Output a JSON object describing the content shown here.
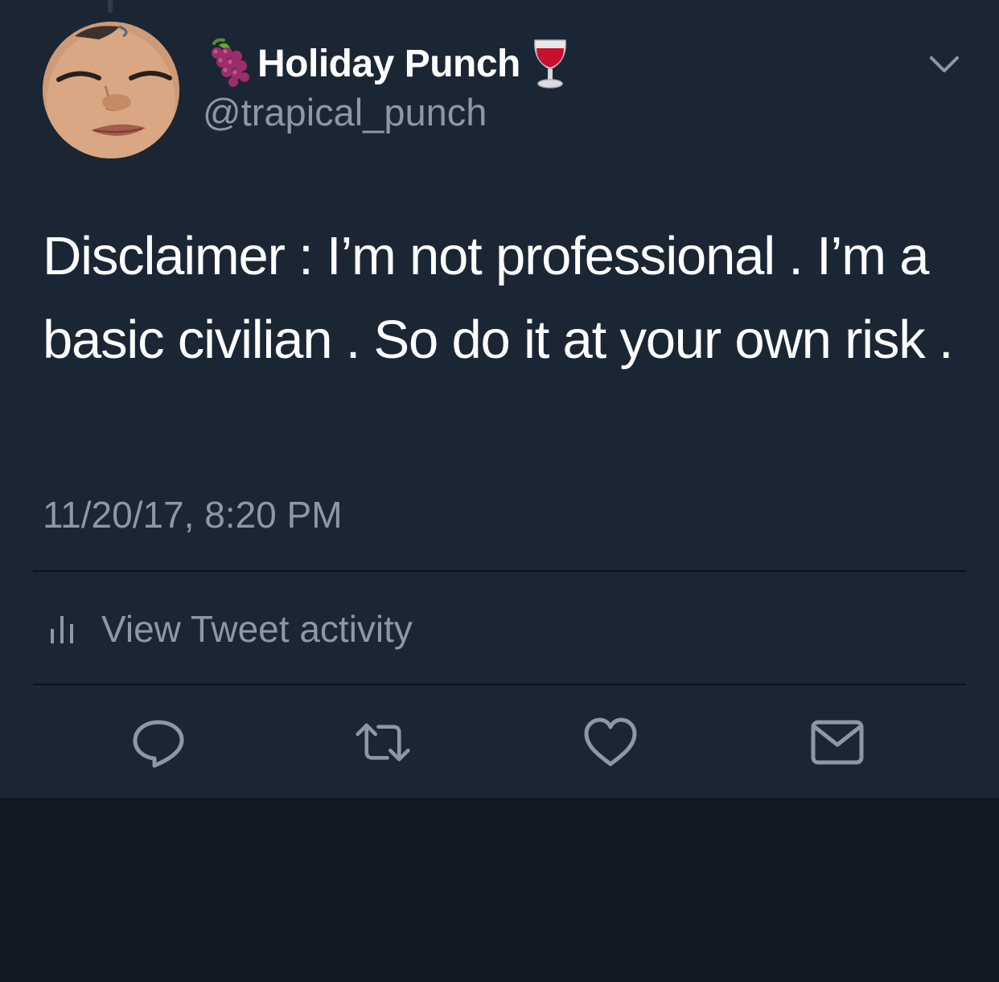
{
  "tweet": {
    "display_name": "Holiday Punch",
    "handle": "@trapical_punch",
    "name_prefix_emoji": "grapes-icon",
    "name_suffix_emoji": "wine-glass-icon",
    "text": "Disclaimer : I’m not professional . I’m a basic civilian . So do it at your own risk .",
    "timestamp": "11/20/17, 8:20 PM"
  },
  "activity": {
    "label": "View Tweet activity",
    "icon": "bar-chart-icon"
  },
  "actions": [
    {
      "name": "reply",
      "icon": "reply-icon"
    },
    {
      "name": "retweet",
      "icon": "retweet-icon"
    },
    {
      "name": "like",
      "icon": "heart-icon"
    },
    {
      "name": "message",
      "icon": "mail-icon"
    }
  ],
  "colors": {
    "background": "#1b2635",
    "text": "#ffffff",
    "secondary_text": "#8b98a7",
    "divider": "#0d1118"
  }
}
